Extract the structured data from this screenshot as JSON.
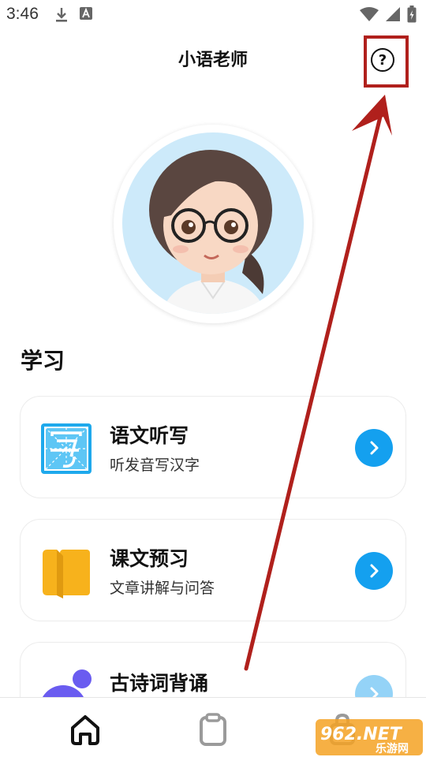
{
  "status_bar": {
    "time": "3:46",
    "icons": [
      "download-icon",
      "font-icon",
      "wifi-icon",
      "signal-icon",
      "battery-icon"
    ]
  },
  "header": {
    "title": "小语老师",
    "help_symbol": "?"
  },
  "section": {
    "title": "学习"
  },
  "cards": [
    {
      "title": "语文听写",
      "subtitle": "听发音写汉字",
      "icon": "dictation-icon",
      "accent": "#14a0ef"
    },
    {
      "title": "课文预习",
      "subtitle": "文章讲解与问答",
      "icon": "book-icon",
      "accent": "#f7b21c"
    },
    {
      "title": "古诗词背诵",
      "subtitle": "",
      "icon": "poem-icon",
      "accent": "#6a5cf0"
    }
  ],
  "bottom_nav": {
    "items": [
      "home-icon",
      "clipboard-icon",
      "bag-icon"
    ],
    "active_color": "#111111",
    "inactive_color": "#9a9a9a"
  },
  "watermark": {
    "logo_text": "962.NET",
    "caption": "乐游网"
  },
  "annotation": {
    "color": "#b0201c"
  }
}
